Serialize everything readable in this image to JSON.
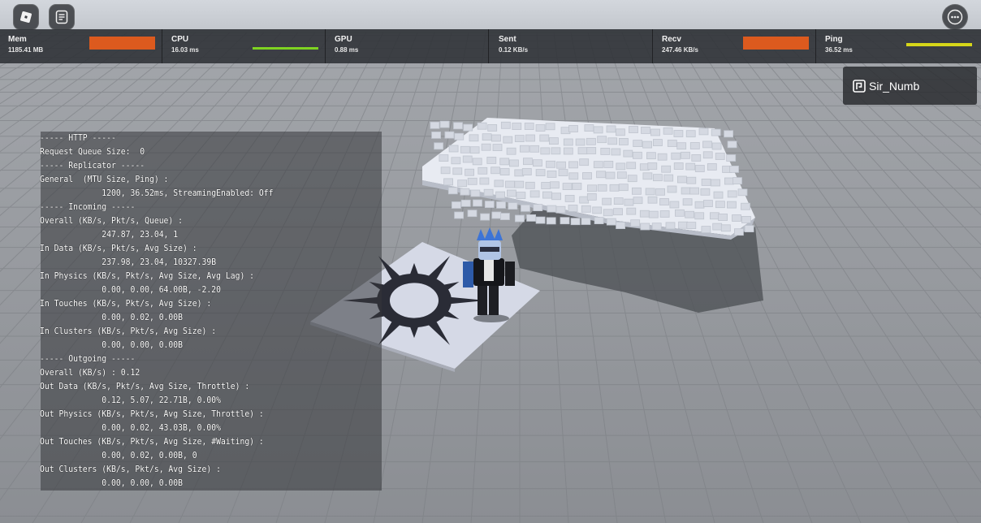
{
  "topbar": {
    "roblox_icon": "roblox-logo-icon",
    "chat_icon": "chat-icon",
    "more_icon": "more-options-icon"
  },
  "stats": [
    {
      "name": "Mem",
      "value": "1185.41 MB",
      "graph": "block",
      "color": "#dc5a1e"
    },
    {
      "name": "CPU",
      "value": "16.03 ms",
      "graph": "line",
      "color": "#7ed321"
    },
    {
      "name": "GPU",
      "value": "0.88 ms",
      "graph": "none",
      "color": ""
    },
    {
      "name": "Sent",
      "value": "0.12 KB/s",
      "graph": "none",
      "color": ""
    },
    {
      "name": "Recv",
      "value": "247.46 KB/s",
      "graph": "block",
      "color": "#dc5a1e"
    },
    {
      "name": "Ping",
      "value": "36.52 ms",
      "graph": "line",
      "color": "#d6d619"
    }
  ],
  "player_list": {
    "player_name": "Sir_Numb",
    "icon": "premium-icon"
  },
  "network_stats": {
    "lines": [
      "----- HTTP -----",
      "Request Queue Size:  0",
      "----- Replicator -----",
      "General  (MTU Size, Ping) :",
      "             1200, 36.52ms, StreamingEnabled: Off",
      "----- Incoming -----",
      "Overall (KB/s, Pkt/s, Queue) :",
      "             247.87, 23.04, 1",
      "In Data (KB/s, Pkt/s, Avg Size) :",
      "             237.98, 23.04, 10327.39B",
      "In Physics (KB/s, Pkt/s, Avg Size, Avg Lag) :",
      "             0.00, 0.00, 64.00B, -2.20",
      "In Touches (KB/s, Pkt/s, Avg Size) :",
      "             0.00, 0.02, 0.00B",
      "In Clusters (KB/s, Pkt/s, Avg Size) :",
      "             0.00, 0.00, 0.00B",
      "----- Outgoing -----",
      "Overall (KB/s) : 0.12",
      "Out Data (KB/s, Pkt/s, Avg Size, Throttle) :",
      "             0.12, 5.07, 22.71B, 0.00%",
      "Out Physics (KB/s, Pkt/s, Avg Size, Throttle) :",
      "             0.00, 0.02, 43.03B, 0.00%",
      "Out Touches (KB/s, Pkt/s, Avg Size, #Waiting) :",
      "             0.00, 0.02, 0.00B, 0",
      "Out Clusters (KB/s, Pkt/s, Avg Size) :",
      "             0.00, 0.00, 0.00B"
    ]
  },
  "scene": {
    "sky_color": "#c9ced6",
    "ground_color": "#8f9297",
    "grid_color": "#7d8085",
    "decal_icon": "sun-decal-icon",
    "character": "player-avatar",
    "block_cluster": "floating-block-cluster"
  }
}
